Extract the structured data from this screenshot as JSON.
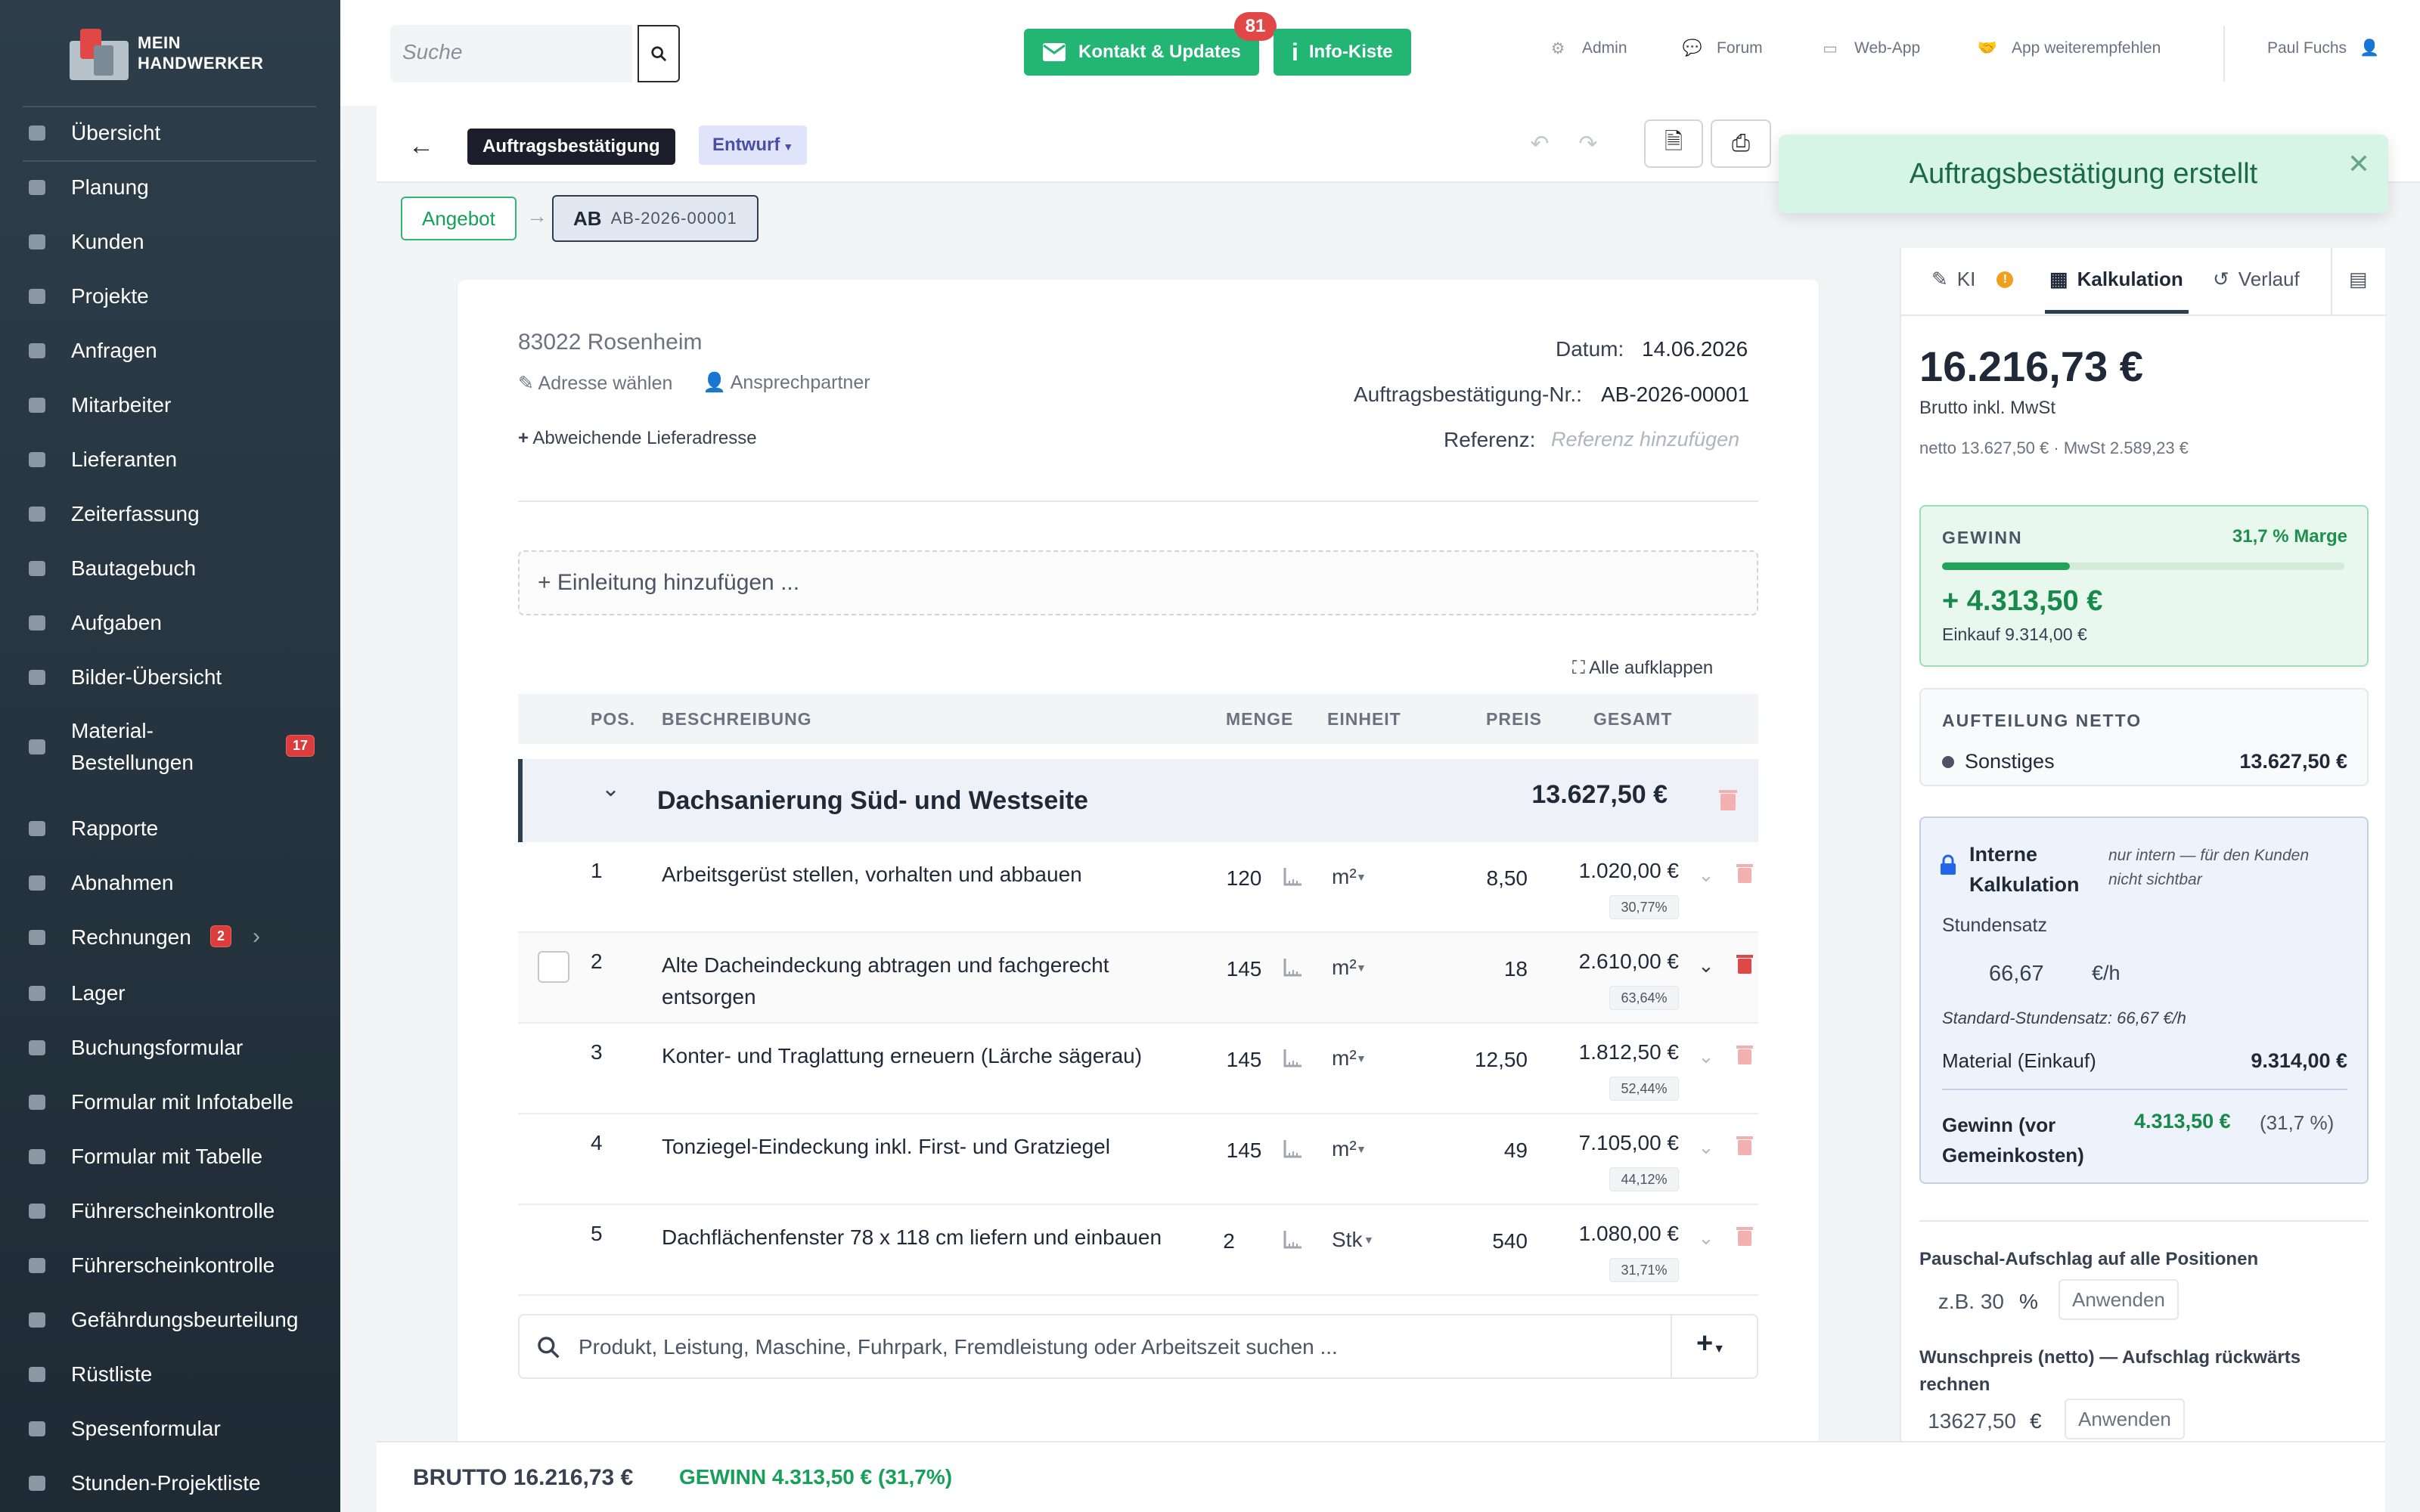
{
  "brand": {
    "line1": "MEIN",
    "line2": "HANDWERKER"
  },
  "sidebar": {
    "items": [
      {
        "label": "Übersicht",
        "icon": "speedometer-icon"
      },
      {
        "label": "Planung",
        "icon": "calendar-icon"
      },
      {
        "label": "Kunden",
        "icon": "users-icon"
      },
      {
        "label": "Projekte",
        "icon": "projects-icon"
      },
      {
        "label": "Anfragen",
        "icon": "handshake-icon"
      },
      {
        "label": "Mitarbeiter",
        "icon": "user-icon"
      },
      {
        "label": "Lieferanten",
        "icon": "industry-icon"
      },
      {
        "label": "Zeiterfassung",
        "icon": "user-clock-icon"
      },
      {
        "label": "Bautagebuch",
        "icon": "book-icon"
      },
      {
        "label": "Aufgaben",
        "icon": "tasks-icon"
      },
      {
        "label": "Bilder-Übersicht",
        "icon": "images-icon"
      },
      {
        "label": "Material-\nBestellungen",
        "icon": "cart-icon",
        "badge": "17"
      },
      {
        "label": "Rapporte",
        "icon": "signature-icon"
      },
      {
        "label": "Abnahmen",
        "icon": "search-icon"
      },
      {
        "label": "Rechnungen",
        "icon": "file-icon",
        "badge": "2"
      },
      {
        "label": "Lager",
        "icon": "warehouse-icon"
      },
      {
        "label": "Buchungsformular",
        "icon": "file-icon"
      },
      {
        "label": "Formular mit Infotabelle",
        "icon": "file-icon"
      },
      {
        "label": "Formular mit Tabelle",
        "icon": "file-icon"
      },
      {
        "label": "Führerscheinkontrolle",
        "icon": "file-icon"
      },
      {
        "label": "Führerscheinkontrolle",
        "icon": "file-icon"
      },
      {
        "label": "Gefährdungsbeurteilung",
        "icon": "file-icon"
      },
      {
        "label": "Rüstliste",
        "icon": "file-icon"
      },
      {
        "label": "Spesenformular",
        "icon": "file-icon"
      },
      {
        "label": "Stunden-Projektliste",
        "icon": "file-icon"
      }
    ]
  },
  "topbar": {
    "search_placeholder": "Suche",
    "kontakt_label": "Kontakt & Updates",
    "kontakt_badge": "81",
    "info_label": "Info-Kiste",
    "links": [
      "Admin",
      "Forum",
      "Web-App",
      "App weiterempfehlen"
    ],
    "user": "Paul Fuchs"
  },
  "doc": {
    "type": "Auftragsbestätigung",
    "status": "Entwurf",
    "chain_prev": "Angebot",
    "chain_cur_type": "AB",
    "chain_cur_no": "AB-2026-00001",
    "toast": "Auftragsbestätigung erstellt",
    "address": "83022 Rosenheim",
    "address_select": "Adresse wählen",
    "contact": "Ansprechpartner",
    "alt_delivery": "Abweichende Lieferadresse",
    "date_label": "Datum:",
    "date": "14.06.2026",
    "no_label": "Auftragsbestätigung-Nr.:",
    "no": "AB-2026-00001",
    "ref_label": "Referenz:",
    "ref_placeholder": "Referenz hinzufügen",
    "intro": "+ Einleitung hinzufügen ...",
    "expand_all": "Alle aufklappen"
  },
  "table": {
    "headers": {
      "pos": "POS.",
      "desc": "BESCHREIBUNG",
      "qty": "MENGE",
      "unit": "EINHEIT",
      "price": "PREIS",
      "total": "GESAMT"
    },
    "group": {
      "title": "Dachsanierung Süd- und Westseite",
      "sum": "13.627,50 €"
    },
    "rows": [
      {
        "pos": "1",
        "desc": "Arbeitsgerüst stellen, vorhalten und abbauen",
        "qty": "120",
        "unit": "m²",
        "price": "8,50",
        "total": "1.020,00 €",
        "pct": "30,77%"
      },
      {
        "pos": "2",
        "desc": "Alte Dacheindeckung abtragen und fachgerecht entsorgen",
        "qty": "145",
        "unit": "m²",
        "price": "18",
        "total": "2.610,00 €",
        "pct": "63,64%"
      },
      {
        "pos": "3",
        "desc": "Konter- und Traglattung erneuern (Lärche sägerau)",
        "qty": "145",
        "unit": "m²",
        "price": "12,50",
        "total": "1.812,50 €",
        "pct": "52,44%"
      },
      {
        "pos": "4",
        "desc": "Tonziegel-Eindeckung inkl. First- und Gratziegel",
        "qty": "145",
        "unit": "m²",
        "price": "49",
        "total": "7.105,00 €",
        "pct": "44,12%"
      },
      {
        "pos": "5",
        "desc": "Dachflächenfenster 78 x 118 cm liefern und einbauen",
        "qty": "2",
        "unit": "Stk",
        "price": "540",
        "total": "1.080,00 €",
        "pct": "31,71%"
      }
    ],
    "product_search": "Produkt, Leistung, Maschine, Fuhrpark, Fremdleistung oder Arbeitszeit suchen ..."
  },
  "panel": {
    "tabs": [
      "KI",
      "Kalkulation",
      "Verlauf"
    ],
    "brutto": "16.216,73 €",
    "brutto_label": "Brutto inkl. MwSt",
    "netto_line": "netto 13.627,50 € · MwSt 2.589,23 €",
    "gewinn_label": "GEWINN",
    "marge": "31,7 % Marge",
    "marge_fraction": 0.317,
    "gewinn_value": "+ 4.313,50 €",
    "einkauf": "Einkauf 9.314,00 €",
    "aufteilung_label": "AUFTEILUNG NETTO",
    "aufteilung_item": "Sonstiges",
    "aufteilung_value": "13.627,50 €",
    "intern_title": "Interne Kalkulation",
    "intern_note": "nur intern — für den Kunden nicht sichtbar",
    "stundensatz_label": "Stundensatz",
    "stundensatz_value": "66,67",
    "stundensatz_unit": "€/h",
    "standard_rate": "Standard-Stundensatz: 66,67 €/h",
    "material_label": "Material (Einkauf)",
    "material_value": "9.314,00 €",
    "gewinn_vor_label": "Gewinn (vor Gemeinkosten)",
    "gewinn_vor_value": "4.313,50 €",
    "gewinn_vor_pct": "(31,7 %)",
    "pauschal_label": "Pauschal-Aufschlag auf alle Positionen",
    "pauschal_placeholder": "z.B. 30",
    "pauschal_unit": "%",
    "apply": "Anwenden",
    "wunsch_label": "Wunschpreis (netto) — Aufschlag rückwärts rechnen",
    "wunsch_value": "13627,50",
    "wunsch_unit": "€"
  },
  "footer": {
    "brutto": "BRUTTO 16.216,73 €",
    "gewinn": "GEWINN 4.313,50 € (31,7%)"
  },
  "colors": {
    "green": "#22b573",
    "sidebar": "#2d3e4a",
    "accent_dark": "#2c3e50",
    "red": "#dc3c3c"
  }
}
